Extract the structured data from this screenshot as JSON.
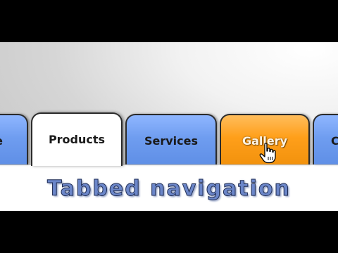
{
  "tabs": [
    {
      "id": "partial-left",
      "label": "e"
    },
    {
      "id": "products",
      "label": "Products"
    },
    {
      "id": "services",
      "label": "Services"
    },
    {
      "id": "gallery",
      "label": "Gallery"
    },
    {
      "id": "partial-right",
      "label": "C"
    }
  ],
  "selected_tab": "Products",
  "hovered_tab": "Gallery",
  "caption": "Tabbed navigation",
  "colors": {
    "tab_blue": "#6f9df0",
    "tab_orange": "#ff9f1a",
    "tab_active": "#ffffff",
    "caption": "#6b86c9"
  }
}
